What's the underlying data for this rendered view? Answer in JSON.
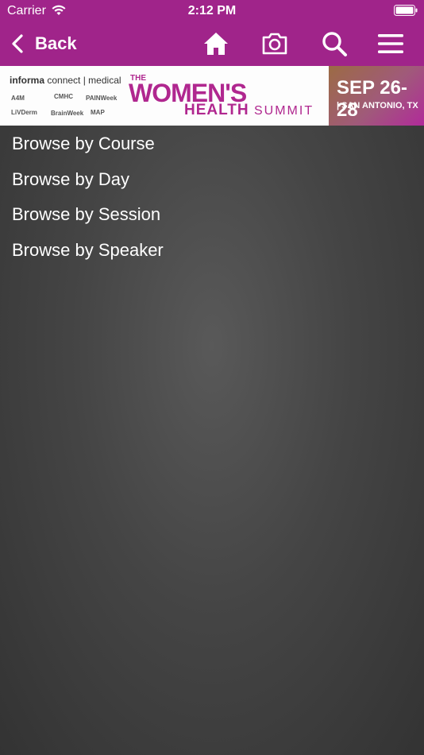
{
  "status_bar": {
    "carrier": "Carrier",
    "time": "2:12 PM"
  },
  "nav": {
    "back_label": "Back",
    "icons": [
      "home-icon",
      "camera-icon",
      "search-icon",
      "menu-icon"
    ]
  },
  "banner": {
    "sponsor_logo": "informa connect | medical",
    "sponsor_name": "informa",
    "sponsor_rest": "connect",
    "sponsor_unit": "| medical",
    "partner_logos": [
      "A4M",
      "CMHC",
      "PAINWeek",
      "LiVDerm",
      "BrainWeek",
      "MAP"
    ],
    "title_the": "THE",
    "title_main": "WOMEN'S",
    "title_health": "HEALTH",
    "title_summit": "SUMMIT",
    "date": "SEP 26-28",
    "location": "| SAN ANTONIO, TX"
  },
  "menu": {
    "items": [
      "Browse by Course",
      "Browse by Day",
      "Browse by Session",
      "Browse by Speaker"
    ]
  },
  "colors": {
    "header_bg": "#a0248a",
    "content_bg": "#454545",
    "text": "#ffffff"
  }
}
